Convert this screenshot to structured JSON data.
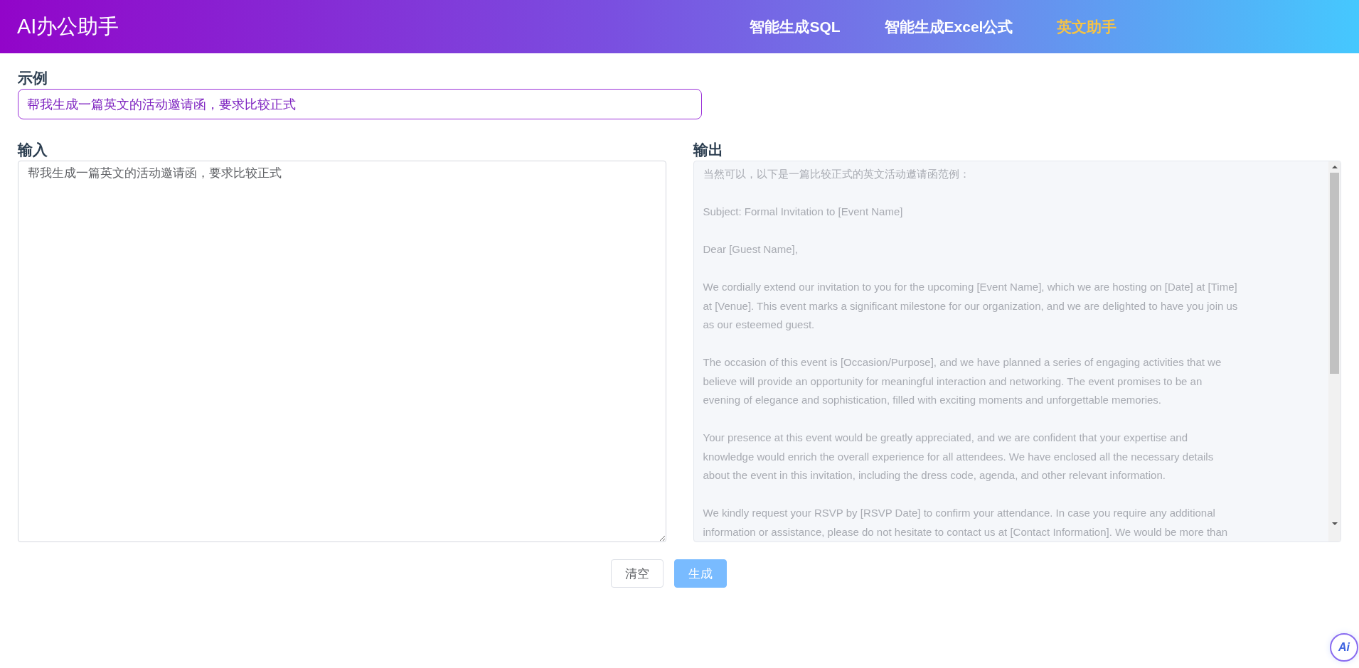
{
  "header": {
    "title": "AI办公助手",
    "nav": [
      {
        "label": "智能生成SQL",
        "selected": false
      },
      {
        "label": "智能生成Excel公式",
        "selected": false
      },
      {
        "label": "英文助手",
        "selected": true
      }
    ]
  },
  "example": {
    "label": "示例",
    "value": "帮我生成一篇英文的活动邀请函，要求比较正式"
  },
  "input": {
    "label": "输入",
    "value": "帮我生成一篇英文的活动邀请函，要求比较正式"
  },
  "output": {
    "label": "输出",
    "paragraphs": [
      "当然可以，以下是一篇比较正式的英文活动邀请函范例：",
      "Subject: Formal Invitation to [Event Name]",
      "Dear [Guest Name],",
      "We cordially extend our invitation to you for the upcoming [Event Name], which we are hosting on [Date] at [Time] at [Venue]. This event marks a significant milestone for our organization, and we are delighted to have you join us as our esteemed guest.",
      "The occasion of this event is [Occasion/Purpose], and we have planned a series of engaging activities that we believe will provide an opportunity for meaningful interaction and networking. The event promises to be an evening of elegance and sophistication, filled with exciting moments and unforgettable memories.",
      "Your presence at this event would be greatly appreciated, and we are confident that your expertise and knowledge would enrich the overall experience for all attendees. We have enclosed all the necessary details about the event in this invitation, including the dress code, agenda, and other relevant information.",
      "We kindly request your RSVP by [RSVP Date] to confirm your attendance. In case you require any additional information or assistance, please do not hesitate to contact us at [Contact Information]. We would be more than"
    ]
  },
  "buttons": [
    {
      "label": "清空",
      "kind": "plain"
    },
    {
      "label": "生成",
      "kind": "primary",
      "disabled": true
    }
  ],
  "assistant": {
    "label": "Ai"
  }
}
